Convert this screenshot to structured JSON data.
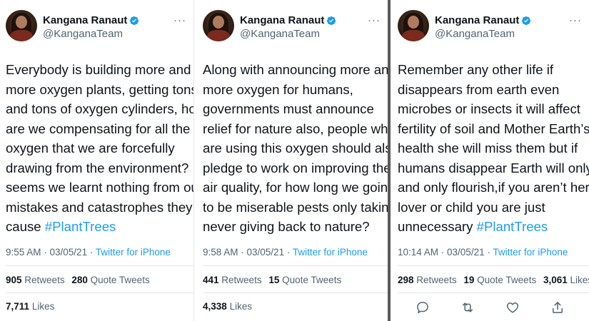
{
  "tweets": [
    {
      "author": {
        "name": "Kangana Ranaut",
        "handle": "@KanganaTeam"
      },
      "lines": [
        "Everybody is building more and",
        "more oxygen plants, getting tons",
        "and tons of oxygen cylinders, how",
        "are we compensating for all the",
        "oxygen that we are forcefully",
        "drawing from the environment? It",
        "seems we learnt nothing from our",
        "mistakes and catastrophes they"
      ],
      "last_line": "cause",
      "hashtag": "#PlantTrees",
      "time": "9:55 AM · 03/05/21 · ",
      "source": "Twitter for iPhone",
      "retweets": "905",
      "retweets_label": "Retweets",
      "quotes": "280",
      "quotes_label": "Quote Tweets",
      "likes": "7,711",
      "likes_label": "Likes"
    },
    {
      "author": {
        "name": "Kangana Ranaut",
        "handle": "@KanganaTeam"
      },
      "lines": [
        "Along with announcing more and",
        "more oxygen for humans,",
        "governments must announce",
        "relief for nature also, people who",
        "are using this oxygen should also",
        "pledge to work on improving the",
        "air quality, for how long we going",
        "to be miserable pests only taking",
        "never giving back to nature?"
      ],
      "time": "9:58 AM · 03/05/21 · ",
      "source": "Twitter for iPhone",
      "retweets": "441",
      "retweets_label": "Retweets",
      "quotes": "15",
      "quotes_label": "Quote Tweets",
      "likes": "4,338",
      "likes_label": "Likes"
    },
    {
      "author": {
        "name": "Kangana Ranaut",
        "handle": "@KanganaTeam"
      },
      "lines": [
        "Remember any other life if",
        "disappears from earth even",
        "microbes or insects it will affect",
        "fertility of soil and Mother Earth’s",
        "health she will miss them but if",
        "humans disappear Earth will only",
        "and only flourish,if you aren’t her",
        "lover or child you are just"
      ],
      "last_line": "unnecessary",
      "hashtag": "#PlantTrees",
      "time": "10:14 AM · 03/05/21 · ",
      "source": "Twitter for iPhone",
      "retweets": "298",
      "retweets_label": "Retweets",
      "quotes": "19",
      "quotes_label": "Quote Tweets",
      "likes": "3,061",
      "likes_label": "Likes"
    }
  ],
  "icons": {
    "more": "more-icon",
    "verified": "verified-badge-icon",
    "reply": "reply-icon",
    "retweet": "retweet-icon",
    "like": "like-icon",
    "share": "share-icon"
  },
  "colors": {
    "link": "#1d9bf0",
    "text": "#0f1419",
    "muted": "#536471"
  }
}
